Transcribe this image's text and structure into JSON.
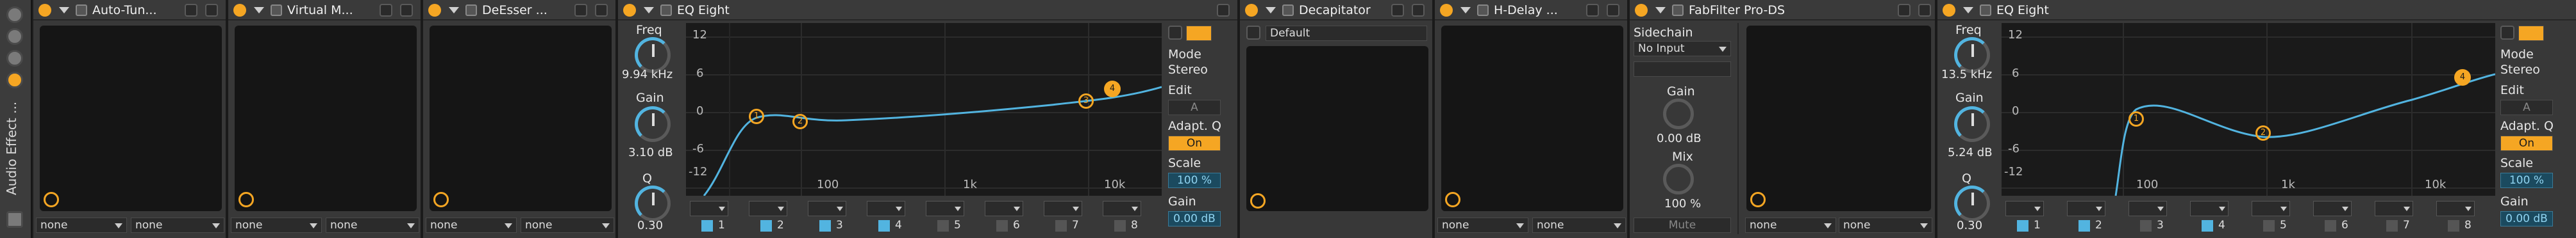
{
  "rack": {
    "title": "Audio Effect ..."
  },
  "devices": {
    "autotune": {
      "name": "Auto-Tun...",
      "select_a": "none",
      "select_b": "none"
    },
    "virtualmix": {
      "name": "Virtual M...",
      "select_a": "none",
      "select_b": "none"
    },
    "desser": {
      "name": "DeEsser ...",
      "select_a": "none",
      "select_b": "none"
    },
    "eq1": {
      "name": "EQ Eight",
      "freq_label": "Freq",
      "freq_value": "9.94 kHz",
      "gain_label": "Gain",
      "gain_value": "3.10 dB",
      "q_label": "Q",
      "q_value": "0.30",
      "db_ticks": [
        "12",
        "6",
        "0",
        "-6",
        "-12"
      ],
      "freq_ticks": [
        "100",
        "1k",
        "10k"
      ],
      "nodes": [
        "1",
        "2",
        "3",
        "4"
      ],
      "bands": [
        "1",
        "2",
        "3",
        "4",
        "5",
        "6",
        "7",
        "8"
      ],
      "mode_label": "Mode",
      "mode_value": "Stereo",
      "edit_label": "Edit",
      "edit_value": "A",
      "adaptq_label": "Adapt. Q",
      "adaptq_value": "On",
      "scale_label": "Scale",
      "scale_value": "100 %",
      "outgain_label": "Gain",
      "outgain_value": "0.00 dB"
    },
    "decapitator": {
      "name": "Decapitator",
      "preset": "Default"
    },
    "hdelay": {
      "name": "H-Delay ...",
      "select_a": "none",
      "select_b": "none"
    },
    "fabfilter": {
      "name": "FabFilter Pro-DS",
      "sidechain_label": "Sidechain",
      "sidechain_value": "No Input",
      "gain_label": "Gain",
      "gain_value": "0.00 dB",
      "mix_label": "Mix",
      "mix_value": "100 %",
      "mute_label": "Mute",
      "select_a": "none",
      "select_b": "none"
    },
    "eq2": {
      "name": "EQ Eight",
      "freq_label": "Freq",
      "freq_value": "13.5 kHz",
      "gain_label": "Gain",
      "gain_value": "5.24 dB",
      "q_label": "Q",
      "q_value": "0.30",
      "db_ticks": [
        "12",
        "6",
        "0",
        "-6",
        "-12"
      ],
      "freq_ticks": [
        "100",
        "1k",
        "10k"
      ],
      "nodes": [
        "1",
        "2",
        "4"
      ],
      "bands": [
        "1",
        "2",
        "3",
        "4",
        "5",
        "6",
        "7",
        "8"
      ],
      "mode_label": "Mode",
      "mode_value": "Stereo",
      "edit_label": "Edit",
      "edit_value": "A",
      "adaptq_label": "Adapt. Q",
      "adaptq_value": "On",
      "scale_label": "Scale",
      "scale_value": "100 %",
      "outgain_label": "Gain",
      "outgain_value": "0.00 dB"
    }
  },
  "colors": {
    "accent": "#f5a623",
    "curve": "#52b4e0",
    "panel": "#383838"
  }
}
